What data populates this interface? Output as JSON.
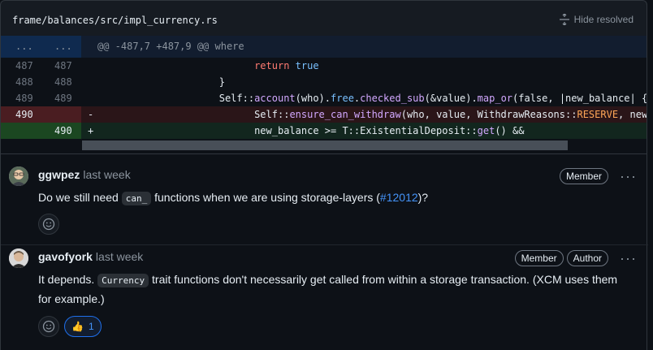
{
  "file": {
    "path": "frame/balances/src/impl_currency.rs",
    "hide_resolved": "Hide resolved"
  },
  "hunk": {
    "left": "...",
    "right": "...",
    "text": "@@ -487,7 +487,9 @@ where"
  },
  "lines": [
    {
      "old": "487",
      "new": "487",
      "type": "context"
    },
    {
      "old": "488",
      "new": "488",
      "type": "context"
    },
    {
      "old": "489",
      "new": "489",
      "type": "context"
    },
    {
      "old": "490",
      "new": "",
      "type": "del",
      "sign": "-"
    },
    {
      "old": "",
      "new": "490",
      "type": "add",
      "sign": "+"
    }
  ],
  "code": {
    "l1_kw": "return",
    "l1_val": "true",
    "l2": "}",
    "l3_a": "Self::",
    "l3_fn1": "account",
    "l3_b": "(who).",
    "l3_fn2": "free",
    "l3_c": ".",
    "l3_fn3": "checked_sub",
    "l3_d": "(&value).",
    "l3_fn4": "map_or",
    "l3_e": "(false, |new_balance| {",
    "l4_a": "Self::",
    "l4_fn": "ensure_can_withdraw",
    "l4_b": "(who, value, WithdrawReasons::",
    "l4_const": "RESERVE",
    "l4_c": ", new_ba",
    "l5_a": "new_balance >= T::ExistentialDeposit::",
    "l5_fn": "get",
    "l5_b": "() &&"
  },
  "comments": [
    {
      "author": "ggwpez",
      "when": "last week",
      "badges": [
        "Member"
      ],
      "text_before": "Do we still need ",
      "code": "can_",
      "text_mid": " functions when we are using storage-layers (",
      "link": "#12012",
      "text_after": ")?"
    },
    {
      "author": "gavofyork",
      "when": "last week",
      "badges": [
        "Member",
        "Author"
      ],
      "text_before": "It depends. ",
      "code": "Currency",
      "text_after": " trait functions don't necessarily get called from within a storage transaction. (XCM uses them for example.)",
      "reaction": {
        "emoji": "👍",
        "count": "1"
      }
    }
  ],
  "kebab": "···"
}
